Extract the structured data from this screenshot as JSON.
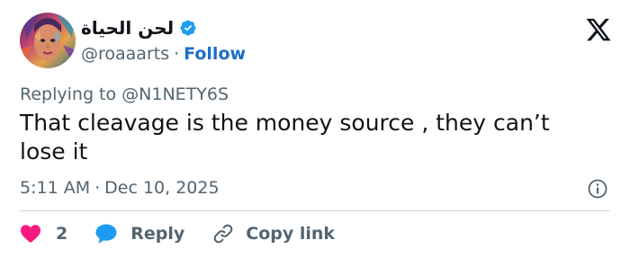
{
  "author": {
    "display_name": "لحن الحياة",
    "handle": "@roaaarts",
    "separator": "·",
    "follow_label": "Follow",
    "verified": true
  },
  "reply_to": {
    "prefix": "Replying to",
    "mention": "@N1NETY6S"
  },
  "tweet": {
    "text": "That cleavage is the money source , they can’t lose it",
    "time": "5:11 AM",
    "separator": "·",
    "date": "Dec 10, 2025"
  },
  "actions": {
    "like_count": "2",
    "reply_label": "Reply",
    "copy_link_label": "Copy link"
  },
  "icons": {
    "verified": "verified-badge-icon",
    "x_logo": "x-logo-icon",
    "info": "info-icon",
    "like": "heart-icon",
    "reply": "speech-bubble-icon",
    "copy_link": "link-icon"
  },
  "colors": {
    "verified": "#1d9bf0",
    "follow": "#1d6ec9",
    "like": "#f91880",
    "reply": "#1d9bf0",
    "secondary_text": "#536471",
    "primary_text": "#0f1419"
  }
}
